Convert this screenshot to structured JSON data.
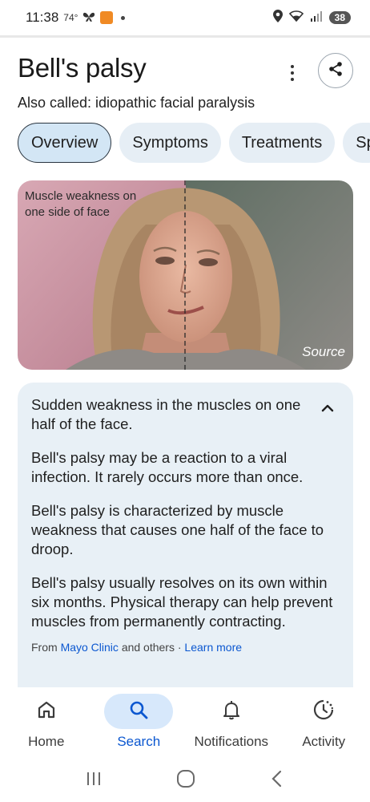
{
  "status_bar": {
    "time": "11:38",
    "temperature": "74°",
    "battery": "38"
  },
  "header": {
    "title": "Bell's palsy",
    "subtitle": "Also called: idiopathic facial paralysis"
  },
  "tabs": [
    {
      "label": "Overview",
      "active": true
    },
    {
      "label": "Symptoms",
      "active": false
    },
    {
      "label": "Treatments",
      "active": false
    },
    {
      "label": "Sp",
      "active": false
    }
  ],
  "image": {
    "caption": "Muscle weakness on one side of face",
    "source_label": "Source"
  },
  "info": {
    "summary": "Sudden weakness in the muscles on one half of the face.",
    "paragraphs": [
      "Bell's palsy may be a reaction to a viral infection. It rarely occurs more than once.",
      "Bell's palsy is characterized by muscle weakness that causes one half of the face to droop.",
      "Bell's palsy usually resolves on its own within six months. Physical therapy can help prevent muscles from permanently contracting."
    ],
    "footer_prefix": "From",
    "footer_link": "Mayo Clinic",
    "footer_middle": "and others ·",
    "footer_more": "Learn more"
  },
  "bottom_nav": [
    {
      "label": "Home",
      "icon": "home-icon",
      "active": false
    },
    {
      "label": "Search",
      "icon": "search-icon",
      "active": true
    },
    {
      "label": "Notifications",
      "icon": "bell-icon",
      "active": false
    },
    {
      "label": "Activity",
      "icon": "activity-icon",
      "active": false
    }
  ],
  "colors": {
    "accent": "#0b57d0",
    "tab_bg": "#e6eef5",
    "card_bg": "#e8f0f6",
    "nav_active_bg": "#d7e8fb"
  }
}
